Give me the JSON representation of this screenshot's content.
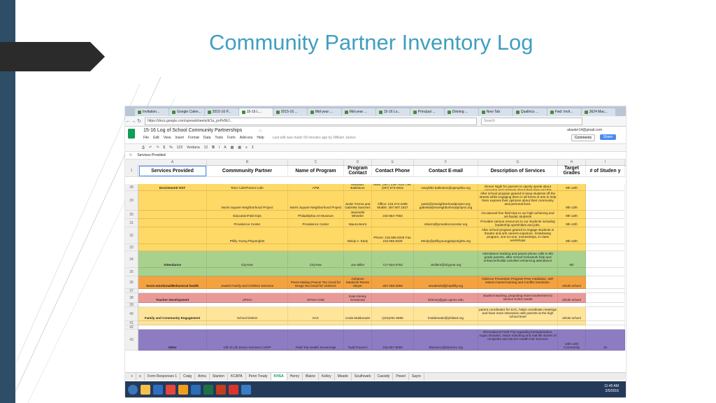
{
  "slide": {
    "title": "Community Partner Inventory Log"
  },
  "browser": {
    "tabs": [
      "Invitation...",
      "Google Calen...",
      "2015-16 P...",
      "15-16 L...",
      "2015-16 ...",
      "Mid-year ...",
      "Mid-year ...",
      "15-16 Lo...",
      "Principal ...",
      "Dinning ...",
      "New Tab",
      "Qualtrics ...",
      "Fwd: Invit...",
      "3624 Mac..."
    ],
    "active_tab_index": 3,
    "url": "https://docs.google.com/spreadsheets/d/1a_pnHxNLf...",
    "search_placeholder": "Search"
  },
  "sheet": {
    "title": "15-16 Log of School Community Partnerships",
    "menus": [
      "File",
      "Edit",
      "View",
      "Insert",
      "Format",
      "Data",
      "Tools",
      "Form",
      "Add-ons",
      "Help"
    ],
    "last_edit": "Last edit was made 59 minutes ago by William James",
    "user_email": "akaster14@gmail.com",
    "comments_label": "Comments",
    "share_label": "Share",
    "toolbar": {
      "zoom": "123",
      "font": "Verdana",
      "size": "12",
      "currency": "$",
      "percent": "%"
    },
    "fx": "fx",
    "formula_value": "Services Provided",
    "columns": [
      "A",
      "B",
      "C",
      "D",
      "E",
      "F",
      "G",
      "H",
      "I"
    ],
    "header": [
      "Services Provided",
      "Commmunity Partner",
      "Name of Program",
      "Program Contact",
      "Contact Phone",
      "Contact E-mail",
      "Description of Services",
      "Target Grades",
      "# of Studen y"
    ],
    "rows": [
      {
        "num": "28",
        "color": "#ffd966",
        "cells": [
          "Enrichment/ OST",
          "Teen Cafe/Parent Cafe",
          "APM",
          "Maryblitz Ballestros",
          "Main: (267) 236-7534 Cell: (267) 973-0031",
          "maryblitz.ballestros@apmphila.org",
          "Dinner Night for parents to openly speak about concerns and opinions about their lives and the community they live in",
          "9th-12th",
          ""
        ]
      },
      {
        "num": "29",
        "color": "#ffd966",
        "cells": [
          "",
          "Norris Square Neighborhood Project",
          "Norris Square Neighborhood Project",
          "Justin Trezza and Gabriela Sanchez",
          "Office: 215.274.2495 Mobile: 267.807.1627",
          "justin@nsneighborhoodproject.org gabriela@nsneighborhoodproject.org",
          "After school program geared to keep students off the streets while engaging them in all forms of arts to help them express their opinions about their community and personal lives.",
          "9th-12th",
          ""
        ]
      },
      {
        "num": "30",
        "color": "#ffd966",
        "cells": [
          "",
          "EducationField trips",
          "Philadelphia Art Museum",
          "Jeannette Wheeler",
          "215-684-7582",
          "",
          "Occasional free field trips to our high achieving and art-fanatic students",
          "9th-12th",
          ""
        ]
      },
      {
        "num": "31",
        "color": "#ffd966",
        "cells": [
          "",
          "Providence Center",
          "Providence Center",
          "Maura Bernt",
          "",
          "mbernt@providencecenter.org",
          "Provides various resources to our students including leadership oportinities and jobs.",
          "9th-12th",
          ""
        ]
      },
      {
        "num": "32",
        "color": "#ffd966",
        "cells": [
          "",
          "Philly Young Playwrights",
          "",
          "Mindy A. Early",
          "Phone: 215.665.9226 Fax: 215.665.9228",
          "Mindy@phillyyoungplaywrights.org",
          "After school program geared to engage students in theatre and arts careers exposure. SHadowing program, one-on-one, mentorships, in-class workshops",
          "9th-12th",
          ""
        ]
      },
      {
        "num": "33",
        "color": "#ffd966",
        "cells": [
          "",
          "",
          "",
          "",
          "",
          "",
          "",
          "",
          ""
        ]
      },
      {
        "num": "34",
        "color": "#a9d18e",
        "cells": [
          "Attendance",
          "CityYear",
          "CityYear",
          "Joe Miller",
          "717-634-0763",
          "Jmiller2@cityyear.org",
          "Attendance tracking and parent phone calls to 9th grade parents, after school homework help and enhancer/Kallar activities enhancing attendance",
          "9th",
          ""
        ]
      },
      {
        "num": "35",
        "color": "#a9d18e",
        "cells": [
          "",
          "",
          "",
          "",
          "",
          "",
          "",
          "",
          ""
        ]
      },
      {
        "num": "36",
        "color": "#f4a240",
        "cells": [
          "Socio-emotional/Behavioral health",
          "Jewish Family and Children Services",
          "Peers Making Peace/ Too Good for Drugs,Too Good for Violence",
          "Adrianne Madnick/ Renee Meyer",
          "267-256-2056",
          "amadnick@jfcsphilly.org",
          "Violence Prevention Program-Peer mediation, self-esteem based training and Conflict resolution.",
          "whole school",
          ""
        ]
      },
      {
        "num": "37",
        "color": "#ffffff",
        "cells": [
          "",
          "",
          "",
          "",
          "",
          "",
          "",
          "",
          ""
        ]
      },
      {
        "num": "38",
        "color": "#ea9999",
        "cells": [
          "Teacher Development",
          "UPenn",
          "UPenn GSE",
          "Kate Kinney Grossman",
          "",
          "kkinney@gse.upenn.edu",
          "student teaching, proposing more involvement to service KHSA needs",
          "whole school",
          ""
        ]
      },
      {
        "num": "39",
        "color": "#ffffff",
        "cells": [
          "",
          "",
          "",
          "",
          "",
          "",
          "",
          "",
          ""
        ]
      },
      {
        "num": "40",
        "color": "#ffe599",
        "cells": [
          "Family and Community Engagement",
          "School District",
          "SAC",
          "Linda Maldonado",
          "(215)291-5680",
          "lmaldonado@philasd.org",
          "parent coordinator for SAC, helps coordinate meetings and have more interaction with parents at the high school level",
          "whole school",
          ""
        ]
      },
      {
        "num": "41",
        "color": "#ffe599",
        "cells": [
          "",
          "",
          "",
          "",
          "",
          "",
          "",
          "",
          ""
        ]
      },
      {
        "num": "42",
        "color": "#ffffff",
        "cells": [
          "",
          "",
          "",
          "",
          "",
          "",
          "",
          "",
          ""
        ]
      },
      {
        "num": "43",
        "color": "#8e7cc3",
        "cells": [
          "Other",
          "Gift of Life Donor Services CHOP",
          "Field Trip Health Screenings",
          "Todd Franzen",
          "215-557-8090",
          "tfranzen1@donors1.org",
          "Informational Field Trip regarding transplantation, organ donation, tissue matching and real-life stories of recipients and donors Health Fair Services",
          "10th-12th Community",
          "15"
        ]
      }
    ],
    "sheet_tabs": [
      "Form Responses 1",
      "Craig",
      "Anha",
      "Stanton",
      "KCAPA",
      "Penn Treaty",
      "KHSA",
      "Henry",
      "Blaine",
      "Kelley",
      "Meade",
      "Southwark",
      "Cassidy",
      "Powel",
      "Sayre"
    ],
    "active_sheet_index": 6
  },
  "taskbar": {
    "time": "11:45 AM",
    "date": "2/5/2016"
  }
}
